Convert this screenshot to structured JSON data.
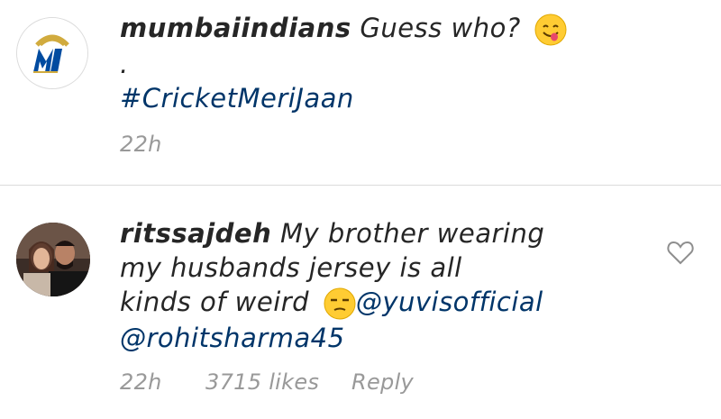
{
  "post": {
    "username": "mumbaiindians",
    "caption": "Guess who?",
    "caption_emoji": "yummy-face-emoji",
    "dot_line": ".",
    "hashtag": "#CricketMeriJaan",
    "time": "22h"
  },
  "comment": {
    "username": "ritssajdeh",
    "line1": "My brother wearing",
    "line2": "my husbands jersey is all",
    "line3": "kinds of weird",
    "emoji": "unamused-face-emoji",
    "mention1": "@yuvisofficial",
    "mention2": "@rohitsharma45",
    "time": "22h",
    "likes": "3715 likes",
    "reply_label": "Reply",
    "like_icon": "heart-outline-icon"
  },
  "colors": {
    "link": "#003569",
    "meta": "#999999",
    "divider": "#dbdbdb",
    "mi_blue": "#004ba0",
    "mi_gold": "#d1ab3e"
  }
}
